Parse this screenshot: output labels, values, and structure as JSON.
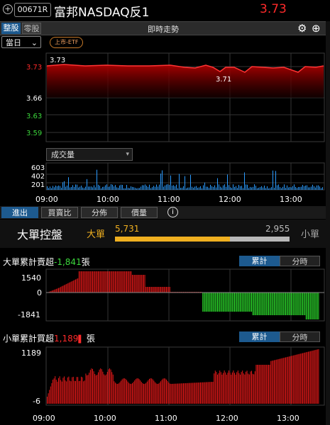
{
  "header": {
    "code": "00671R",
    "name": "富邦NASDAQ反1",
    "price": "3.73"
  },
  "tabs": {
    "board_lot": "整股",
    "odd_lot": "零股",
    "title": "即時走勢"
  },
  "controls": {
    "day_select": "當日",
    "badge": "上市-ETF",
    "volume_select": "成交量"
  },
  "price_chart": {
    "y_labels": [
      "3.73",
      "3.66",
      "3.63",
      "3.59"
    ],
    "y_label_colors": [
      "#ff2a2a",
      "#ffffff",
      "#3cd83c",
      "#3cd83c"
    ],
    "high_label": "3.73",
    "low_label": "3.71",
    "line_color": "#ff2a2a"
  },
  "volume_chart": {
    "y_labels": [
      "603",
      "402",
      "201"
    ],
    "bar_color": "#2b9bff"
  },
  "time_axis": [
    "09:00",
    "10:00",
    "11:00",
    "12:00",
    "13:00"
  ],
  "bottom_tabs": [
    "進出",
    "買賣比",
    "分佈",
    "價量"
  ],
  "big_order": {
    "title": "大單控盤",
    "large_label": "大單",
    "small_label": "小單",
    "large_value": "5,731",
    "small_value": "2,955",
    "large_ratio": 0.66
  },
  "large_cum": {
    "label_prefix": "大單累計賣超",
    "value": "-1,841",
    "unit": "張",
    "toggle_on": "累計",
    "toggle_off": "分時",
    "y_labels": [
      "1540",
      "0",
      "-1841"
    ]
  },
  "small_cum": {
    "label_prefix": "小單累計買超",
    "value": "1,189",
    "unit": "張",
    "toggle_on": "累計",
    "toggle_off": "分時",
    "y_labels": [
      "1189",
      "-6"
    ]
  },
  "icons": {
    "add_watch": "plus-circle-icon",
    "settings": "gear-icon",
    "add": "add-circle-icon",
    "info": "info-icon",
    "dropdown": "chevron-down-icon"
  }
}
